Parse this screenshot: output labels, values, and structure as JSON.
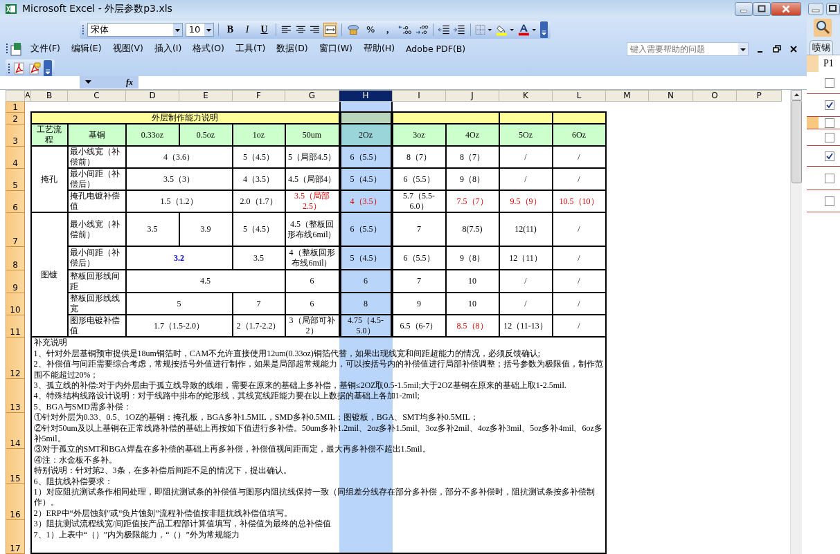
{
  "window": {
    "title": "Microsoft Excel - 外层参数p3.xls"
  },
  "toolbar": {
    "font": "宋体",
    "size": "10",
    "buttons": [
      {
        "label": "B",
        "kind": "bold"
      },
      {
        "label": "I",
        "kind": "italic"
      },
      {
        "label": "U",
        "kind": "underline"
      }
    ],
    "merge_pressed": true,
    "percent": "%",
    "comma": ","
  },
  "menu": [
    "文件(F)",
    "编辑(E)",
    "视图(V)",
    "插入(I)",
    "格式(O)",
    "工具(T)",
    "数据(D)",
    "窗口(W)",
    "帮助(H)",
    "Adobe PDF(B)"
  ],
  "help": {
    "placeholder": "键入需要帮助的问题"
  },
  "formula_bar": {
    "fx": "fx"
  },
  "columns": [
    {
      "label": "A",
      "selected": false
    },
    {
      "label": "B",
      "selected": false
    },
    {
      "label": "C",
      "selected": false
    },
    {
      "label": "D",
      "selected": false
    },
    {
      "label": "E",
      "selected": false
    },
    {
      "label": "F",
      "selected": false
    },
    {
      "label": "G",
      "selected": false
    },
    {
      "label": "H",
      "selected": true
    },
    {
      "label": "I",
      "selected": false
    },
    {
      "label": "J",
      "selected": false
    },
    {
      "label": "K",
      "selected": false
    },
    {
      "label": "L",
      "selected": false
    },
    {
      "label": "M",
      "selected": false
    },
    {
      "label": "N",
      "selected": false
    },
    {
      "label": "O",
      "selected": false
    },
    {
      "label": "P",
      "selected": false
    }
  ],
  "rows": [
    {
      "number": "1"
    },
    {
      "number": "2",
      "cells": [
        {
          "text": "外层制作能力说明",
          "colspan": 6,
          "kind": "title"
        },
        {
          "kind": "title"
        },
        {
          "colspan": 2,
          "kind": "title"
        },
        {
          "kind": "title"
        },
        {
          "kind": "title"
        }
      ]
    },
    {
      "number": "3",
      "cells": [
        {
          "text": "工艺流程",
          "kind": "header"
        },
        {
          "text": "基铜",
          "kind": "header"
        },
        {
          "text": "0.33oz",
          "kind": "header"
        },
        {
          "text": "0.5oz",
          "kind": "header"
        },
        {
          "text": "1oz",
          "kind": "header"
        },
        {
          "text": "50um",
          "kind": "header"
        },
        {
          "text": "2Oz",
          "kind": "header"
        },
        {
          "text": "3oz",
          "kind": "header"
        },
        {
          "text": "4Oz",
          "kind": "header"
        },
        {
          "text": "5Oz",
          "kind": "header"
        },
        {
          "text": "6Oz",
          "kind": "header"
        }
      ]
    },
    {
      "number": "4",
      "cells": [
        {
          "text": "掩孔",
          "rowspan": 3
        },
        {
          "text": "最小线宽（补偿前）",
          "kind": "label"
        },
        {
          "text": "4（3.6）",
          "colspan": 2
        },
        {
          "text": "5（4.5）"
        },
        {
          "text": "5（局部4.5）"
        },
        {
          "text": "6（5.5）"
        },
        {
          "text": "8（7）"
        },
        {
          "text": "8（7）"
        },
        {
          "text": "/"
        },
        {
          "text": "/"
        }
      ]
    },
    {
      "number": "5",
      "cells": [
        {
          "text": "最小间距（补偿后）",
          "kind": "label"
        },
        {
          "text": "3.5（3）",
          "colspan": 2
        },
        {
          "text": "4（3.5）"
        },
        {
          "text": "4.5（局部4）"
        },
        {
          "text": "5（4.5）"
        },
        {
          "text": "6（5.5）"
        },
        {
          "text": "9（8）"
        },
        {
          "text": "/"
        },
        {
          "text": "/"
        }
      ]
    },
    {
      "number": "6",
      "cells": [
        {
          "text": "掩孔电镀补偿值",
          "kind": "label"
        },
        {
          "text": "1.5（1.2）",
          "colspan": 2
        },
        {
          "text": "2.0（1.7）"
        },
        {
          "text": "3.5（局部2.5）",
          "color": "#dd0000"
        },
        {
          "text": "4（3.5）",
          "color": "#dd0000"
        },
        {
          "text": "5.7（5.5-6.0）"
        },
        {
          "text": "7.5（7）",
          "color": "#dd0000"
        },
        {
          "text": "9.5（9）",
          "color": "#dd0000"
        },
        {
          "text": "10.5（10）",
          "color": "#dd0000"
        }
      ]
    },
    {
      "number": "7",
      "cells": [
        {
          "text": "图镀",
          "rowspan": 5
        },
        {
          "text": "最小线宽（补偿前）",
          "kind": "label"
        },
        {
          "text": "3.5"
        },
        {
          "text": "3.9"
        },
        {
          "text": "5（4.5）"
        },
        {
          "text": "4.5（整板回形布线6mil）"
        },
        {
          "text": "6（5.5）"
        },
        {
          "text": "7"
        },
        {
          "text": "8(7.5)"
        },
        {
          "text": "12(11)"
        },
        {
          "text": "/"
        }
      ]
    },
    {
      "number": "8",
      "cells": [
        {
          "text": "最小间距（补偿后）",
          "kind": "label"
        },
        {
          "text": "3.2",
          "colspan": 2,
          "color": "#0000cc",
          "bold": true
        },
        {
          "text": "3.5"
        },
        {
          "text": "4（整板回形布线6mil）"
        },
        {
          "text": "5（4.5）"
        },
        {
          "text": "6（5.5）"
        },
        {
          "text": "9（8）"
        },
        {
          "text": "12（11）"
        },
        {
          "text": "/"
        }
      ]
    },
    {
      "number": "9",
      "cells": [
        {
          "text": "整板回形线间距",
          "kind": "label"
        },
        {
          "text": "4.5",
          "colspan": 3
        },
        {
          "text": "6"
        },
        {
          "text": "6"
        },
        {
          "text": "7"
        },
        {
          "text": "10"
        },
        {
          "text": "/"
        },
        {
          "text": "/"
        }
      ]
    },
    {
      "number": "10",
      "cells": [
        {
          "text": "整板回形线线宽",
          "kind": "label"
        },
        {
          "text": "5",
          "colspan": 2
        },
        {
          "text": "7"
        },
        {
          "text": "6"
        },
        {
          "text": "8"
        },
        {
          "text": "9"
        },
        {
          "text": "10"
        },
        {
          "text": "/"
        },
        {
          "text": "/"
        }
      ]
    },
    {
      "number": "11",
      "cells": [
        {
          "text": "图形电镀补偿值",
          "kind": "label"
        },
        {
          "text": "1.7（1.5-2.0）",
          "colspan": 2
        },
        {
          "text": "2（1.7-2.2）"
        },
        {
          "text": "3（局部可补2）"
        },
        {
          "text": "4.75（4.5-5.0）"
        },
        {
          "text": "6.5（6-7）"
        },
        {
          "text": "8.5（8）",
          "color": "#dd0000"
        },
        {
          "text": "12（11-13）"
        },
        {
          "text": "/"
        }
      ]
    },
    {
      "number": "12",
      "cells": [
        {
          "kind": "notes",
          "colspan": 11,
          "rowspan": 6,
          "lines": [
            "补充说明",
            "1、针对外层基铜预审提供是18um铜箔时，CAM不允许直接使用12um(0.33oz)铜箔代替，如果出现线宽和间距超能力的情况，必须反馈确认;",
            "2、补偿值与间距需要综合考虑，常规按括号外值进行制作，如果是局部超常规能力，可以按括号内的补偿值进行局部补偿调整；括号参数为极限值，制作范围不能超过20%；",
            "3、孤立线的补偿:对于内外层由于孤立线导致的线细，需要在原来的基础上多补偿，基铜≤2OZ取0.5-1.5mil;大于2OZ基铜在原来的基础上取1-2.5mil.",
            "4、特殊结构线路设计说明：对于线路中排布的蛇形线，其线宽线距能力要在以上数据的基础上各加1-2mil;",
            "5、BGA与SMD需多补偿：",
            "①针对外层为0.33、0.5、1OZ的基铜：掩孔板，BGA多补1.5MIL，SMD多补0.5MIL；图镀板，BGA、SMT均多补0.5MIL；",
            "②针对50um及以上基铜在正常线路补偿的基础上再按如下值进行多补偿。50um多补1.2mil、2oz多补1.5mil、3oz多补2mil、4oz多补3mil、5oz多补4mil、6oz多补5mil。",
            "③对于孤立的SMT和BGA焊盘在多补偿的基础上再多补偿，补偿值视间距而定，最大再多补偿不超出1.5mil。",
            "④注：水金板不多补。",
            "特别说明：针对第2、3条，在多补偿后间距不足的情况下，提出确认。",
            "6、阻抗线补偿要求：",
            "1）对应阻抗测试条作相同处理，即阻抗测试条的补偿值与图形内阻抗线保持一致（同组差分线存在部分多补偿，部分不多补偿时，阻抗测试条按多补偿制作）。",
            "2）ERP中“外层蚀刻”或“负片蚀刻”流程补偿值按非阻抗线补偿值填写。",
            "3）阻抗测试流程线宽/间距值按产品工程部计算值填写，补偿值为最终的总补偿值",
            "7、1）上表中“（）”内为极限能力，“（）”外为常规能力"
          ]
        }
      ]
    },
    {
      "number": "13"
    },
    {
      "number": "14"
    },
    {
      "number": "15"
    },
    {
      "number": "16"
    },
    {
      "number": "17"
    }
  ],
  "side_window": {
    "tab": "喷锡",
    "header": "P1",
    "rows": [
      {
        "checked": false,
        "selected": false
      },
      {
        "checked": true,
        "selected": false
      },
      {
        "checked": false,
        "selected": true
      },
      {
        "checked": false,
        "selected": false
      },
      {
        "checked": true,
        "selected": false
      },
      {
        "checked": false,
        "selected": false
      },
      {
        "checked": false,
        "selected": false
      }
    ]
  }
}
